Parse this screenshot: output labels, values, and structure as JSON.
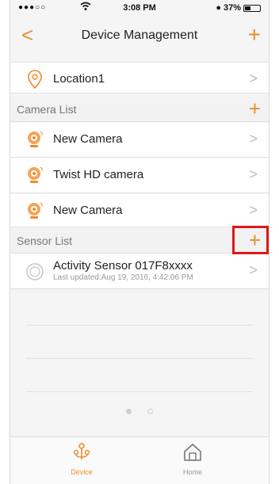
{
  "status_bar": {
    "signal": "●●●○○",
    "time": "3:08 PM",
    "battery": "37%",
    "battery_level": 0.37
  },
  "nav": {
    "back_glyph": "<",
    "title": "Device Management",
    "add_glyph": "+"
  },
  "location": {
    "label": "Location1",
    "icon": "location-pin-icon"
  },
  "camera_section": {
    "title": "Camera List",
    "add_glyph": "+",
    "items": [
      {
        "label": "New Camera",
        "icon": "camera-icon"
      },
      {
        "label": "Twist HD camera",
        "icon": "camera-icon"
      },
      {
        "label": "New Camera",
        "icon": "camera-icon"
      }
    ]
  },
  "sensor_section": {
    "title": "Sensor List",
    "add_glyph": "+",
    "items": [
      {
        "label": "Activity Sensor 017F8xxxx",
        "sub": "Last updated:Aug 19, 2016, 4:42:06 PM",
        "icon": "sensor-icon"
      }
    ]
  },
  "chevron": ">",
  "tabbar": {
    "tabs": [
      {
        "label": "Device",
        "icon": "device-icon",
        "active": true
      },
      {
        "label": "Home",
        "icon": "home-icon",
        "active": false
      }
    ]
  },
  "colors": {
    "accent": "#f08a2a",
    "highlight": "#e01818"
  }
}
